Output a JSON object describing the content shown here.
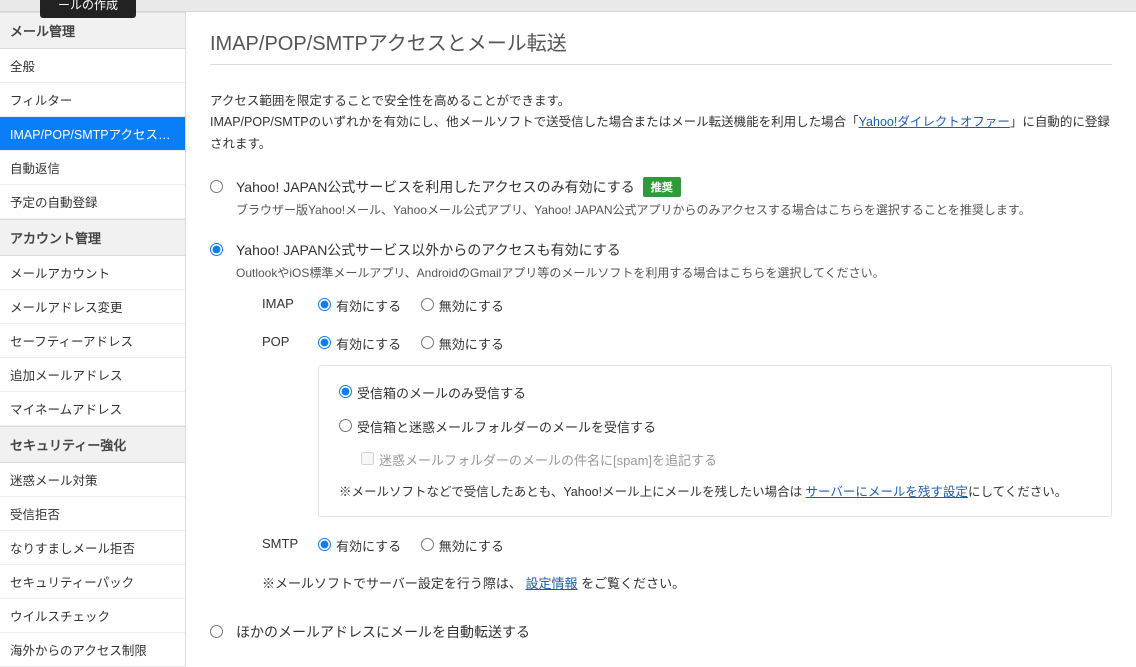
{
  "compose_label": "ールの作成",
  "sidebar": {
    "mail_mgmt": {
      "title": "メール管理",
      "items": [
        "全般",
        "フィルター",
        "IMAP/POP/SMTPアクセス…",
        "自動返信",
        "予定の自動登録"
      ]
    },
    "account_mgmt": {
      "title": "アカウント管理",
      "items": [
        "メールアカウント",
        "メールアドレス変更",
        "セーフティーアドレス",
        "追加メールアドレス",
        "マイネームアドレス"
      ]
    },
    "security": {
      "title": "セキュリティー強化",
      "items": [
        "迷惑メール対策",
        "受信拒否",
        "なりすましメール拒否",
        "セキュリティーパック",
        "ウイルスチェック",
        "海外からのアクセス制限"
      ]
    }
  },
  "page": {
    "title": "IMAP/POP/SMTPアクセスとメール転送"
  },
  "intro": {
    "line1": "アクセス範囲を限定することで安全性を高めることができます。",
    "line2a": "IMAP/POP/SMTPのいずれかを有効にし、他メールソフトで送受信した場合またはメール転送機能を利用した場合「",
    "link": "Yahoo!ダイレクトオファー",
    "line2b": "」に自動的に登録されます。"
  },
  "opt1": {
    "title": "Yahoo! JAPAN公式サービスを利用したアクセスのみ有効にする",
    "badge": "推奨",
    "desc": "ブラウザー版Yahoo!メール、Yahooメール公式アプリ、Yahoo! JAPAN公式アプリからのみアクセスする場合はこちらを選択することを推奨します。"
  },
  "opt2": {
    "title": "Yahoo! JAPAN公式サービス以外からのアクセスも有効にする",
    "desc": "OutlookやiOS標準メールアプリ、AndroidのGmailアプリ等のメールソフトを利用する場合はこちらを選択してください。"
  },
  "proto": {
    "imap": "IMAP",
    "pop": "POP",
    "smtp": "SMTP",
    "enable": "有効にする",
    "disable": "無効にする"
  },
  "pop": {
    "inbox_only": "受信箱のメールのみ受信する",
    "with_spam": "受信箱と迷惑メールフォルダーのメールを受信する",
    "spam_tag": "迷惑メールフォルダーのメールの件名に[spam]を追記する",
    "note_a": "※メールソフトなどで受信したあとも、Yahoo!メール上にメールを残したい場合は ",
    "note_link": "サーバーにメールを残す設定",
    "note_b": "にしてください。"
  },
  "footnote": {
    "a": "※メールソフトでサーバー設定を行う際は、",
    "link": "設定情報",
    "b": " をご覧ください。"
  },
  "opt3": {
    "title": "ほかのメールアドレスにメールを自動転送する"
  }
}
